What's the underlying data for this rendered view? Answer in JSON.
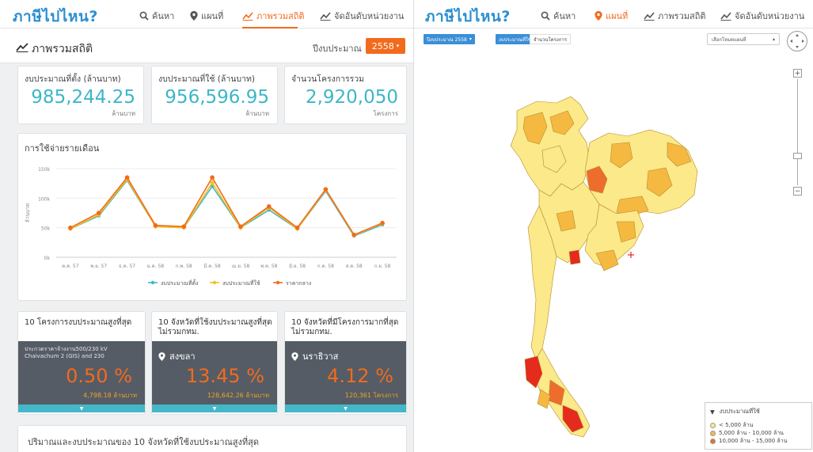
{
  "left_nav": {
    "brand": "ภาษีไปไหน?",
    "items": [
      {
        "label": "ค้นหา",
        "icon": "search-icon"
      },
      {
        "label": "แผนที่",
        "icon": "pin-icon"
      },
      {
        "label": "ภาพรวมสถิติ",
        "icon": "chart-icon"
      },
      {
        "label": "จัดอันดับหน่วยงาน",
        "icon": "chart-icon"
      }
    ]
  },
  "right_nav": {
    "brand": "ภาษีไปไหน?",
    "items": [
      {
        "label": "ค้นหา",
        "icon": "search-icon"
      },
      {
        "label": "แผนที่",
        "icon": "pin-icon"
      },
      {
        "label": "ภาพรวมสถิติ",
        "icon": "chart-icon"
      },
      {
        "label": "จัดอันดับหน่วยงาน",
        "icon": "chart-icon"
      }
    ]
  },
  "overview": {
    "title": "ภาพรวมสถิติ",
    "year_label": "ปีงบประมาณ",
    "year_value": "2558"
  },
  "stats": [
    {
      "label": "งบประมาณที่ตั้ง (ล้านบาท)",
      "value": "985,244.25",
      "unit": "ล้านบาท"
    },
    {
      "label": "งบประมาณที่ใช้ (ล้านบาท)",
      "value": "956,596.95",
      "unit": "ล้านบาท"
    },
    {
      "label": "จำนวนโครงการรวม",
      "value": "2,920,050",
      "unit": "โครงการ"
    }
  ],
  "monthly_chart": {
    "title": "การใช้จ่ายรายเดือน",
    "ylabel": "ล้านบาท",
    "legend": [
      "งบประมาณที่ตั้ง",
      "งบประมาณที่ใช้",
      "ราคากลาง"
    ]
  },
  "chart_data": {
    "type": "line",
    "categories": [
      "ต.ค. 57",
      "พ.ย. 57",
      "ธ.ค. 57",
      "ม.ค. 58",
      "ก.พ. 58",
      "มี.ค. 58",
      "เม.ย. 58",
      "พ.ค. 58",
      "มิ.ย. 58",
      "ก.ค. 58",
      "ส.ค. 58",
      "ก.ย. 58"
    ],
    "series": [
      {
        "name": "งบประมาณที่ตั้ง",
        "color": "#44b7c8",
        "values": [
          48,
          70,
          130,
          52,
          50,
          120,
          50,
          80,
          48,
          112,
          36,
          55
        ]
      },
      {
        "name": "งบประมาณที่ใช้",
        "color": "#f2c21d",
        "values": [
          48,
          72,
          132,
          52,
          50,
          126,
          50,
          84,
          48,
          114,
          37,
          57
        ]
      },
      {
        "name": "ราคากลาง",
        "color": "#f26b1d",
        "values": [
          50,
          75,
          135,
          54,
          52,
          135,
          52,
          86,
          50,
          115,
          38,
          58
        ]
      }
    ],
    "yticks": [
      "0k",
      "50k",
      "100k",
      "150k"
    ],
    "ylim": [
      0,
      150
    ],
    "grid": true,
    "legend_position": "bottom"
  },
  "top_cards": [
    {
      "title": "10 โครงการงบประมาณสูงที่สุด",
      "sub": "ประกวดราคาจ้างงาน500/230 kV Chaivachum 2 (GIS) and 230",
      "percent": "0.50 %",
      "detail": "4,798.18 ล้านบาท"
    },
    {
      "title": "10 จังหวัดที่ใช้งบประมาณสูงที่สุด ไม่รวมกทม.",
      "place": "สงขลา",
      "percent": "13.45 %",
      "detail": "128,642.26 ล้านบาท"
    },
    {
      "title": "10 จังหวัดที่มีโครงการมากที่สุด ไม่รวมกทม.",
      "place": "นราธิวาส",
      "percent": "4.12 %",
      "detail": "120,361 โครงการ"
    }
  ],
  "bottom_card": {
    "title": "ปริมาณและงบประมาณของ 10 จังหวัดที่ใช้งบประมาณสูงที่สุด"
  },
  "map": {
    "tabs": [
      "ปีงบประมาณ 2558",
      "งบประมาณที่ใช้",
      "จำนวนโครงการ"
    ],
    "select_label": "เลือกโหมดแผนที่",
    "legend_title": "งบประมาณที่ใช้",
    "legend_items": [
      {
        "label": "< 5,000 ล้าน",
        "color": "#fbe98a"
      },
      {
        "label": "5,000 ล้าน - 10,000 ล้าน",
        "color": "#f5b942"
      },
      {
        "label": "10,000 ล้าน - 15,000 ล้าน",
        "color": "#ee6c2c"
      }
    ],
    "colors": {
      "low": "#fbe98a",
      "mid": "#f5b942",
      "high": "#ee6c2c",
      "top": "#e52a1e"
    }
  }
}
